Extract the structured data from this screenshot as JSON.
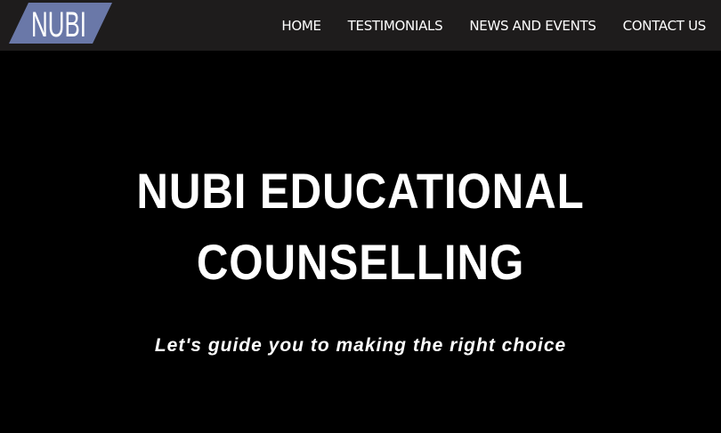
{
  "brand": {
    "logo_text": "NUBI",
    "logo_color": "#6a78a8"
  },
  "nav": {
    "items": [
      {
        "label": "HOME"
      },
      {
        "label": "TESTIMONIALS"
      },
      {
        "label": "NEWS AND EVENTS"
      },
      {
        "label": "CONTACT US"
      }
    ]
  },
  "hero": {
    "title_line1": "NUBI EDUCATIONAL",
    "title_line2": "COUNSELLING",
    "subtitle": "Let's guide you to making the right choice"
  },
  "colors": {
    "navbar_bg": "#1e1c1c",
    "hero_bg": "#000000",
    "text": "#ffffff"
  }
}
